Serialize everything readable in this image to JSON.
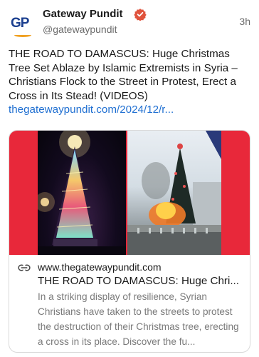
{
  "account": {
    "avatar_text": "GP",
    "display_name": "Gateway Pundit",
    "handle": "@gatewaypundit",
    "timestamp": "3h"
  },
  "post": {
    "text": "THE ROAD TO DAMASCUS: Huge Christmas Tree Set Ablaze by Islamic Extremists in Syria – Christians Flock to the Street in Protest, Erect a Cross in Its Stead! (VIDEOS)",
    "link_text": "thegatewaypundit.com/2024/12/r..."
  },
  "link_card": {
    "domain": "www.thegatewaypundit.com",
    "title": "THE ROAD TO DAMASCUS: Huge Chri...",
    "description": "In a striking display of resilience, Syrian Christians have taken to the streets to protest the destruction of their Christmas tree, erecting a cross in its place. Discover the fu..."
  },
  "colors": {
    "link_blue": "#1f6fd1",
    "verified_orange": "#e0533d",
    "card_red_frame": "#e8283a"
  },
  "icons": {
    "verified": "verified-badge-icon",
    "link": "link-chain-icon"
  }
}
